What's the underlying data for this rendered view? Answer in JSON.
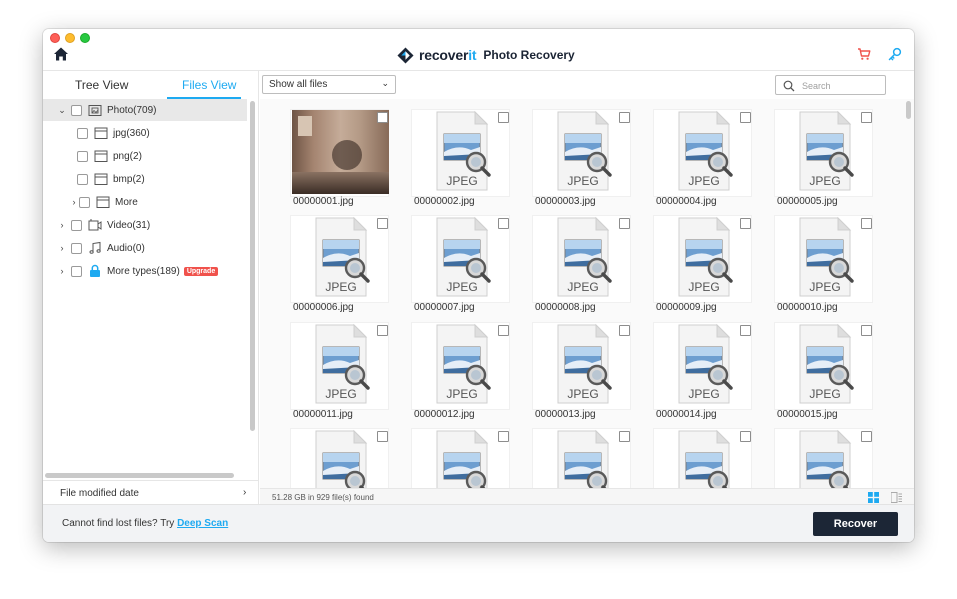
{
  "app": {
    "brand_prefix": "recover",
    "brand_suffix": "it",
    "subtitle": "Photo Recovery"
  },
  "sidebar": {
    "tabs": [
      {
        "label": "Tree View",
        "active": false
      },
      {
        "label": "Files View",
        "active": true
      }
    ],
    "tree": [
      {
        "label": "Photo(709)",
        "expanded": true,
        "selected": true,
        "icon": "photo-folder-icon"
      },
      {
        "label": "jpg(360)",
        "icon": "folder-icon"
      },
      {
        "label": "png(2)",
        "icon": "folder-icon"
      },
      {
        "label": "bmp(2)",
        "icon": "folder-icon"
      },
      {
        "label": "More",
        "collapsed": true,
        "icon": "folder-icon"
      },
      {
        "label": "Video(31)",
        "collapsed": true,
        "icon": "video-icon"
      },
      {
        "label": "Audio(0)",
        "collapsed": true,
        "icon": "music-icon"
      },
      {
        "label": "More types(189)",
        "collapsed": true,
        "icon": "lock-icon",
        "badge": "Upgrade"
      }
    ],
    "filter_label": "File modified date"
  },
  "toolbar": {
    "filter_select": "Show all files",
    "search_placeholder": "Search"
  },
  "files": [
    {
      "name": "00000001.jpg",
      "kind": "photo"
    },
    {
      "name": "00000002.jpg",
      "kind": "jpeg"
    },
    {
      "name": "00000003.jpg",
      "kind": "jpeg"
    },
    {
      "name": "00000004.jpg",
      "kind": "jpeg"
    },
    {
      "name": "00000005.jpg",
      "kind": "jpeg"
    },
    {
      "name": "00000006.jpg",
      "kind": "jpeg"
    },
    {
      "name": "00000007.jpg",
      "kind": "jpeg"
    },
    {
      "name": "00000008.jpg",
      "kind": "jpeg"
    },
    {
      "name": "00000009.jpg",
      "kind": "jpeg"
    },
    {
      "name": "00000010.jpg",
      "kind": "jpeg"
    },
    {
      "name": "00000011.jpg",
      "kind": "jpeg"
    },
    {
      "name": "00000012.jpg",
      "kind": "jpeg"
    },
    {
      "name": "00000013.jpg",
      "kind": "jpeg"
    },
    {
      "name": "00000014.jpg",
      "kind": "jpeg"
    },
    {
      "name": "00000015.jpg",
      "kind": "jpeg"
    },
    {
      "name": "",
      "kind": "jpeg"
    },
    {
      "name": "",
      "kind": "jpeg"
    },
    {
      "name": "",
      "kind": "jpeg"
    },
    {
      "name": "",
      "kind": "jpeg"
    },
    {
      "name": "",
      "kind": "jpeg"
    }
  ],
  "jpeg_label": "JPEG",
  "status": {
    "summary": "51.28 GB in 929 file(s) found"
  },
  "footer": {
    "prompt": "Cannot find lost files? Try ",
    "link": "Deep Scan",
    "recover_label": "Recover"
  },
  "colors": {
    "accent": "#1eaaf1",
    "button_dark": "#1c2636",
    "upgrade_badge": "#f0524c",
    "cart_icon": "#f0524c"
  }
}
